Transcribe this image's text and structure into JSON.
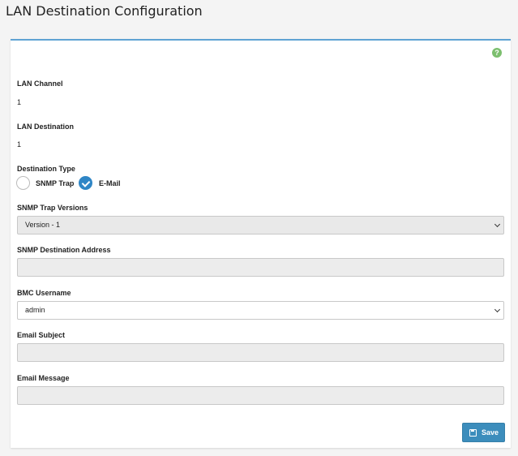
{
  "page": {
    "title": "LAN Destination Configuration"
  },
  "form": {
    "lan_channel_label": "LAN Channel",
    "lan_channel_value": "1",
    "lan_destination_label": "LAN Destination",
    "lan_destination_value": "1",
    "destination_type_label": "Destination Type",
    "destination_type_options": [
      {
        "label": "SNMP Trap",
        "checked": false
      },
      {
        "label": "E-Mail",
        "checked": true
      }
    ],
    "snmp_trap_versions_label": "SNMP Trap Versions",
    "snmp_trap_versions_value": "Version - 1",
    "snmp_destination_address_label": "SNMP Destination Address",
    "snmp_destination_address_value": "",
    "bmc_username_label": "BMC Username",
    "bmc_username_value": "admin",
    "email_subject_label": "Email Subject",
    "email_subject_value": "",
    "email_message_label": "Email Message",
    "email_message_value": "",
    "save_label": "Save"
  },
  "icons": {
    "help": "help-circle-icon",
    "save": "floppy-disk-icon",
    "check": "checkmark-icon",
    "dropdown": "chevron-down-icon"
  },
  "colors": {
    "accent": "#3c8dbc",
    "panel_top_border": "#5fa3d3",
    "help_icon": "#7cbf6e"
  }
}
